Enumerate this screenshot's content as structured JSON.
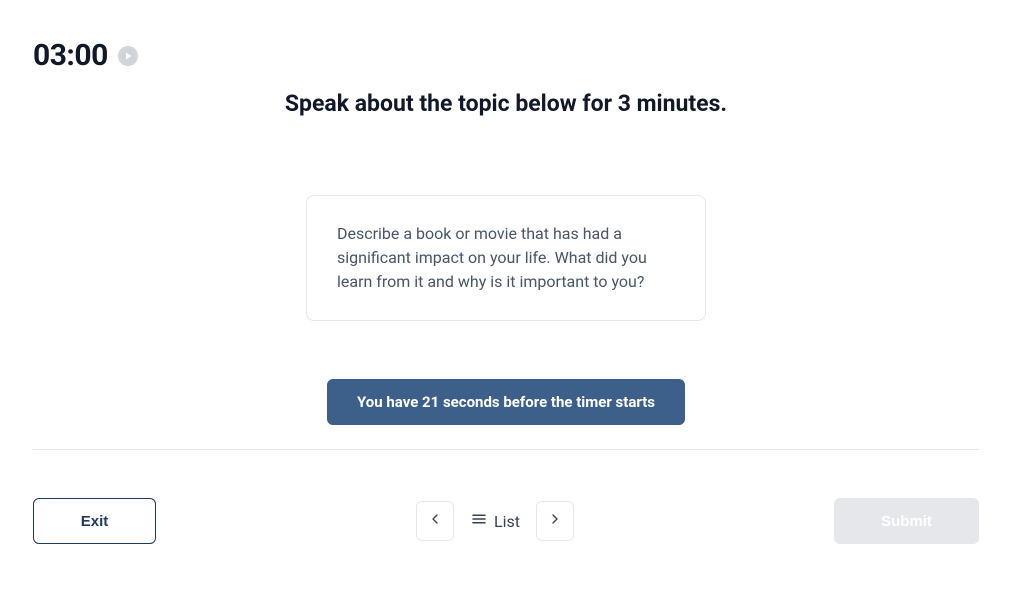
{
  "timer": {
    "display": "03:00"
  },
  "instruction": "Speak about the topic below for 3 minutes.",
  "topic": {
    "prompt": "Describe a book or movie that has had a significant impact on your life. What did you learn from it and why is it important to you?"
  },
  "countdown": {
    "message": "You have 21 seconds before the timer starts"
  },
  "footer": {
    "exit_label": "Exit",
    "list_label": "List",
    "submit_label": "Submit"
  }
}
